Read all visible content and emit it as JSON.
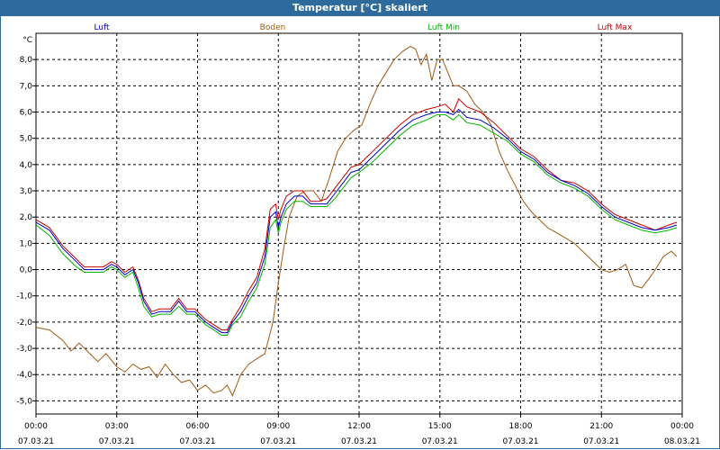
{
  "window": {
    "title": "Temperatur [°C] skaliert"
  },
  "chart_data": {
    "type": "line",
    "title": "Temperatur [°C] skaliert",
    "ylabel": "°C",
    "xlabel": "",
    "ylim": [
      -5.5,
      9.0
    ],
    "y_ticks": [
      8.0,
      7.0,
      6.0,
      5.0,
      4.0,
      3.0,
      2.0,
      1.0,
      0.0,
      -1.0,
      -2.0,
      -3.0,
      -4.0,
      -5.0
    ],
    "y_tick_labels": [
      "8,0",
      "7,0",
      "6,0",
      "5,0",
      "4,0",
      "3,0",
      "2,0",
      "1,0",
      "0,0",
      "-1,0",
      "-2,0",
      "-3,0",
      "-4,0",
      "-5,0"
    ],
    "x_range": [
      0,
      24
    ],
    "x_ticks": [
      0,
      3,
      6,
      9,
      12,
      15,
      18,
      21,
      24
    ],
    "x_tick_times": [
      "00:00",
      "03:00",
      "06:00",
      "09:00",
      "12:00",
      "15:00",
      "18:00",
      "21:00",
      "00:00"
    ],
    "x_tick_dates": [
      "07.03.21",
      "07.03.21",
      "07.03.21",
      "07.03.21",
      "07.03.21",
      "07.03.21",
      "07.03.21",
      "07.03.21",
      "08.03.21"
    ],
    "grid": true,
    "legend_position": "top",
    "series": [
      {
        "name": "Luft",
        "color": "#0000c8",
        "x": [
          0,
          0.5,
          1,
          1.5,
          1.8,
          2,
          2.5,
          2.8,
          3,
          3.3,
          3.6,
          3.8,
          4,
          4.3,
          4.6,
          4.8,
          5,
          5.3,
          5.6,
          5.9,
          6,
          6.3,
          6.6,
          6.9,
          7.1,
          7.3,
          7.6,
          7.9,
          8.2,
          8.5,
          8.7,
          8.9,
          9.0,
          9.1,
          9.3,
          9.6,
          9.9,
          10.2,
          10.5,
          10.8,
          11.1,
          11.4,
          11.7,
          12,
          12.5,
          13,
          13.5,
          14,
          14.5,
          14.9,
          15.2,
          15.5,
          15.7,
          16,
          16.5,
          17,
          17.5,
          18,
          18.5,
          19,
          19.5,
          20,
          20.5,
          21,
          21.5,
          22,
          22.5,
          23,
          23.5,
          23.8
        ],
        "values": [
          1.8,
          1.5,
          0.8,
          0.3,
          0.0,
          0.0,
          0.0,
          0.2,
          0.1,
          -0.2,
          0.0,
          -0.5,
          -1.2,
          -1.7,
          -1.6,
          -1.6,
          -1.6,
          -1.2,
          -1.6,
          -1.6,
          -1.7,
          -2.0,
          -2.2,
          -2.4,
          -2.4,
          -2.0,
          -1.6,
          -1.0,
          -0.5,
          0.5,
          2.0,
          2.2,
          1.6,
          2.0,
          2.5,
          2.8,
          2.8,
          2.5,
          2.5,
          2.5,
          2.9,
          3.3,
          3.7,
          3.8,
          4.3,
          4.8,
          5.3,
          5.7,
          5.9,
          6.0,
          6.0,
          5.9,
          6.1,
          5.8,
          5.7,
          5.4,
          5.0,
          4.5,
          4.2,
          3.7,
          3.4,
          3.2,
          2.9,
          2.4,
          2.0,
          1.8,
          1.6,
          1.5,
          1.6,
          1.7
        ]
      },
      {
        "name": "Boden",
        "color": "#a05a10",
        "x": [
          0,
          0.5,
          1,
          1.3,
          1.6,
          2,
          2.3,
          2.6,
          3,
          3.3,
          3.6,
          3.9,
          4.2,
          4.5,
          4.8,
          5.1,
          5.4,
          5.7,
          6.0,
          6.3,
          6.6,
          6.9,
          7.1,
          7.3,
          7.6,
          7.9,
          8.2,
          8.5,
          8.8,
          9.0,
          9.2,
          9.4,
          9.7,
          10,
          10.3,
          10.6,
          10.9,
          11.2,
          11.5,
          11.8,
          12.1,
          12.4,
          12.7,
          13,
          13.3,
          13.6,
          13.9,
          14.1,
          14.3,
          14.5,
          14.7,
          14.9,
          15.1,
          15.3,
          15.5,
          15.7,
          16.0,
          16.3,
          16.6,
          16.9,
          17.2,
          17.5,
          17.8,
          18.1,
          18.4,
          18.7,
          19,
          19.5,
          20,
          20.5,
          21,
          21.3,
          21.6,
          21.9,
          22.2,
          22.5,
          22.8,
          23,
          23.3,
          23.6,
          23.8
        ],
        "values": [
          -2.2,
          -2.3,
          -2.7,
          -3.1,
          -2.8,
          -3.2,
          -3.5,
          -3.2,
          -3.7,
          -3.9,
          -3.6,
          -3.8,
          -3.7,
          -4.1,
          -3.6,
          -4.0,
          -4.3,
          -4.2,
          -4.6,
          -4.4,
          -4.7,
          -4.6,
          -4.4,
          -4.8,
          -4.0,
          -3.6,
          -3.4,
          -3.2,
          -2.0,
          -0.5,
          0.8,
          2.0,
          2.8,
          3.0,
          3.0,
          2.6,
          3.5,
          4.5,
          5.0,
          5.3,
          5.5,
          6.3,
          7.0,
          7.5,
          8.0,
          8.3,
          8.5,
          8.4,
          7.8,
          8.2,
          7.2,
          8.0,
          8.0,
          7.5,
          7.0,
          7.0,
          6.8,
          6.3,
          6.0,
          5.5,
          4.5,
          3.8,
          3.2,
          2.6,
          2.2,
          1.9,
          1.6,
          1.3,
          1.0,
          0.5,
          0.0,
          -0.1,
          0.0,
          0.2,
          -0.6,
          -0.7,
          -0.3,
          0.0,
          0.5,
          0.7,
          0.5
        ]
      },
      {
        "name": "Luft Min",
        "color": "#00b400",
        "x": [
          0,
          0.5,
          1,
          1.5,
          1.8,
          2,
          2.5,
          2.8,
          3,
          3.3,
          3.6,
          3.8,
          4,
          4.3,
          4.6,
          4.8,
          5,
          5.3,
          5.6,
          5.9,
          6,
          6.3,
          6.6,
          6.9,
          7.1,
          7.3,
          7.6,
          7.9,
          8.2,
          8.5,
          8.7,
          8.9,
          9.0,
          9.1,
          9.3,
          9.6,
          9.9,
          10.2,
          10.5,
          10.8,
          11.1,
          11.4,
          11.7,
          12,
          12.5,
          13,
          13.5,
          14,
          14.5,
          14.9,
          15.2,
          15.5,
          15.7,
          16,
          16.5,
          17,
          17.5,
          18,
          18.5,
          19,
          19.5,
          20,
          20.5,
          21,
          21.5,
          22,
          22.5,
          23,
          23.5,
          23.8
        ],
        "values": [
          1.7,
          1.3,
          0.6,
          0.1,
          -0.1,
          -0.1,
          -0.1,
          0.1,
          0.0,
          -0.3,
          -0.1,
          -0.7,
          -1.4,
          -1.8,
          -1.7,
          -1.7,
          -1.7,
          -1.4,
          -1.7,
          -1.7,
          -1.8,
          -2.1,
          -2.3,
          -2.5,
          -2.5,
          -2.1,
          -1.8,
          -1.2,
          -0.7,
          0.2,
          1.6,
          1.9,
          1.4,
          1.8,
          2.3,
          2.6,
          2.6,
          2.4,
          2.4,
          2.4,
          2.7,
          3.1,
          3.5,
          3.7,
          4.1,
          4.6,
          5.1,
          5.5,
          5.7,
          5.9,
          5.9,
          5.7,
          5.9,
          5.6,
          5.5,
          5.2,
          4.9,
          4.4,
          4.1,
          3.6,
          3.3,
          3.1,
          2.8,
          2.3,
          1.9,
          1.7,
          1.5,
          1.4,
          1.5,
          1.6
        ]
      },
      {
        "name": "Luft Max",
        "color": "#c80000",
        "x": [
          0,
          0.5,
          1,
          1.5,
          1.8,
          2,
          2.5,
          2.8,
          3,
          3.3,
          3.6,
          3.8,
          4,
          4.3,
          4.6,
          4.8,
          5,
          5.3,
          5.6,
          5.9,
          6,
          6.3,
          6.6,
          6.9,
          7.1,
          7.3,
          7.6,
          7.9,
          8.2,
          8.5,
          8.7,
          8.9,
          9.0,
          9.1,
          9.3,
          9.6,
          9.9,
          10.2,
          10.5,
          10.8,
          11.1,
          11.4,
          11.7,
          12,
          12.5,
          13,
          13.5,
          14,
          14.5,
          14.9,
          15.2,
          15.5,
          15.7,
          16,
          16.5,
          17,
          17.5,
          18,
          18.5,
          19,
          19.5,
          20,
          20.5,
          21,
          21.5,
          22,
          22.5,
          23,
          23.5,
          23.8
        ],
        "values": [
          1.9,
          1.6,
          0.9,
          0.4,
          0.1,
          0.1,
          0.1,
          0.3,
          0.2,
          -0.1,
          0.1,
          -0.4,
          -1.1,
          -1.6,
          -1.5,
          -1.5,
          -1.5,
          -1.1,
          -1.5,
          -1.5,
          -1.6,
          -1.9,
          -2.1,
          -2.3,
          -2.3,
          -1.9,
          -1.4,
          -0.8,
          -0.3,
          0.8,
          2.3,
          2.5,
          1.9,
          2.3,
          2.8,
          3.0,
          3.0,
          2.6,
          2.6,
          2.7,
          3.1,
          3.5,
          3.9,
          4.0,
          4.5,
          5.0,
          5.5,
          5.9,
          6.1,
          6.2,
          6.3,
          6.0,
          6.5,
          6.2,
          6.0,
          5.6,
          5.1,
          4.6,
          4.3,
          3.8,
          3.4,
          3.3,
          3.0,
          2.5,
          2.1,
          1.9,
          1.7,
          1.5,
          1.7,
          1.8
        ]
      }
    ]
  }
}
